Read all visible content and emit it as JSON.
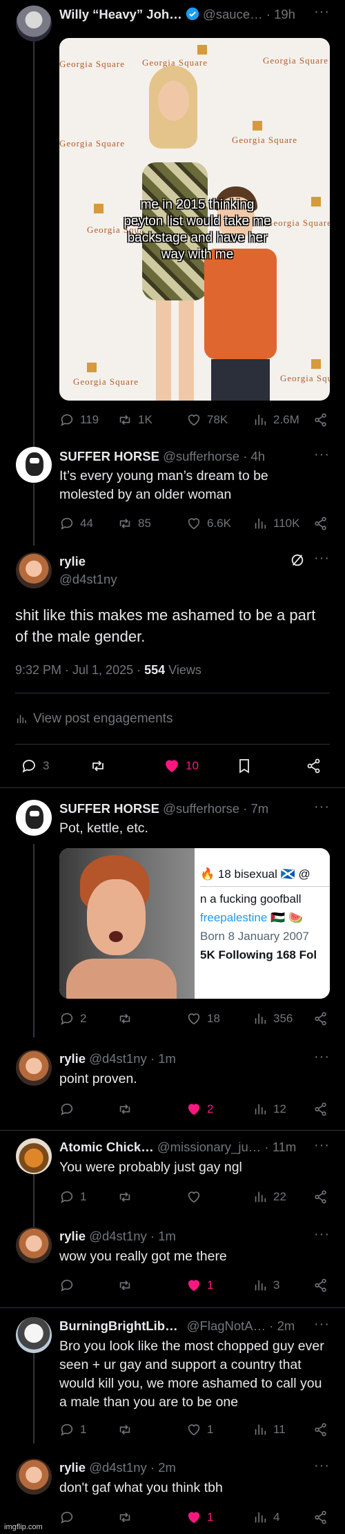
{
  "post1": {
    "name": "Willy “Heavy” Joh…",
    "handle": "@sauce…",
    "time": "· 19h",
    "caption": "me in 2015 thinking peyton list would take me backstage and have her way with me",
    "backdrop_text": "Georgia Square",
    "replies": "119",
    "reposts": "1K",
    "likes": "78K",
    "views": "2.6M"
  },
  "post2": {
    "name": "SUFFER HORSE",
    "handle": "@sufferhorse",
    "time": "· 4h",
    "text": "It’s every young man’s dream to be molested by an older woman",
    "replies": "44",
    "reposts": "85",
    "likes": "6.6K",
    "views": "110K"
  },
  "main": {
    "name": "rylie",
    "handle": "@d4st1ny",
    "text": "shit like this makes me ashamed to be a part of the male gender.",
    "timestamp": "9:32 PM · Jul 1, 2025 · ",
    "views_count": "554",
    "views_label": " Views",
    "engagements": "View post engagements",
    "replies": "3",
    "likes": "10"
  },
  "reply1": {
    "name": "SUFFER HORSE",
    "handle": "@sufferhorse",
    "time": "· 7m",
    "text": "Pot, kettle, etc.",
    "screenshot_lines": [
      "🔥 18 bisexual 🏴󠁧󠁢󠁳󠁣󠁴󠁿 @",
      "n a fucking goofball",
      "freepalestine 🇵🇸 🍉",
      "Born 8 January 2007",
      "5K Following  168 Fol"
    ],
    "replies": "2",
    "likes": "18",
    "views": "356"
  },
  "reply2": {
    "name": "rylie",
    "handle": "@d4st1ny",
    "time": "· 1m",
    "text": "point proven.",
    "likes": "2",
    "views": "12"
  },
  "reply3": {
    "name": "Atomic Chick…",
    "handle": "@missionary_ju…",
    "time": "· 11m",
    "text": "You were probably just gay ngl",
    "replies": "1",
    "views": "22"
  },
  "reply4": {
    "name": "rylie",
    "handle": "@d4st1ny",
    "time": "· 1m",
    "text": "wow you really got me there",
    "likes": "1",
    "views": "3"
  },
  "reply5": {
    "name": "BurningBrightLib…",
    "handle": "@FlagNotA…",
    "time": "· 2m",
    "text": "Bro you look like the most chopped guy ever seen + ur gay and support a country that would kill you, we more ashamed to call you a male than you are to be one",
    "replies": "1",
    "likes": "1",
    "views": "11"
  },
  "reply6": {
    "name": "rylie",
    "handle": "@d4st1ny",
    "time": "· 2m",
    "text": "don't gaf what you think tbh",
    "likes": "1",
    "views": "4"
  },
  "watermark": "imgflip.com",
  "colors": {
    "like_pink": "#f91880",
    "verified_blue": "#1d9bf0",
    "muted": "#71767b"
  }
}
